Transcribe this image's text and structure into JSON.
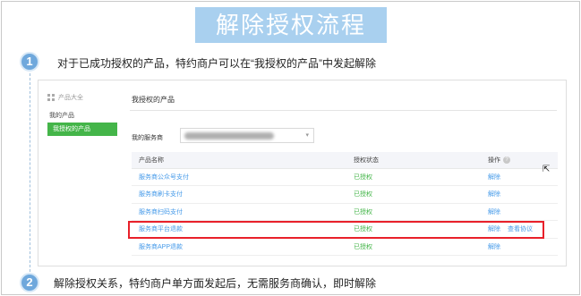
{
  "title": "解除授权流程",
  "steps": [
    {
      "number": "1",
      "text": "对于已成功授权的产品，特约商户可以在“我授权的产品”中发起解除"
    },
    {
      "number": "2",
      "text": "解除授权关系，特约商户单方面发起后，无需服务商确认，即时解除"
    }
  ],
  "colors": {
    "banner": "#a9d0ef",
    "badge": "#6fa8dc",
    "active_nav": "#44b549",
    "link": "#459ae9",
    "highlight": "#e8202a"
  },
  "app": {
    "sidebar": {
      "header": "产品大全",
      "header_icon": "grid-icon",
      "items": [
        {
          "label": "我的产品",
          "active": false
        },
        {
          "label": "我授权的产品",
          "active": true
        }
      ]
    },
    "main": {
      "title": "我授权的产品",
      "vendor": {
        "label": "我的服务商",
        "value": ""
      },
      "table": {
        "headers": {
          "name": "产品名称",
          "status": "授权状态",
          "action": "操作"
        },
        "rows": [
          {
            "name": "服务商公众号支付",
            "status": "已授权",
            "actions": [
              "解除"
            ]
          },
          {
            "name": "服务商刷卡支付",
            "status": "已授权",
            "actions": [
              "解除"
            ]
          },
          {
            "name": "服务商扫码支付",
            "status": "已授权",
            "actions": [
              "解除"
            ]
          },
          {
            "name": "服务商平台退款",
            "status": "已授权",
            "actions": [
              "解除",
              "查看协议"
            ],
            "highlighted": true
          },
          {
            "name": "服务商APP退款",
            "status": "已授权",
            "actions": [
              "解除"
            ]
          }
        ]
      }
    }
  }
}
